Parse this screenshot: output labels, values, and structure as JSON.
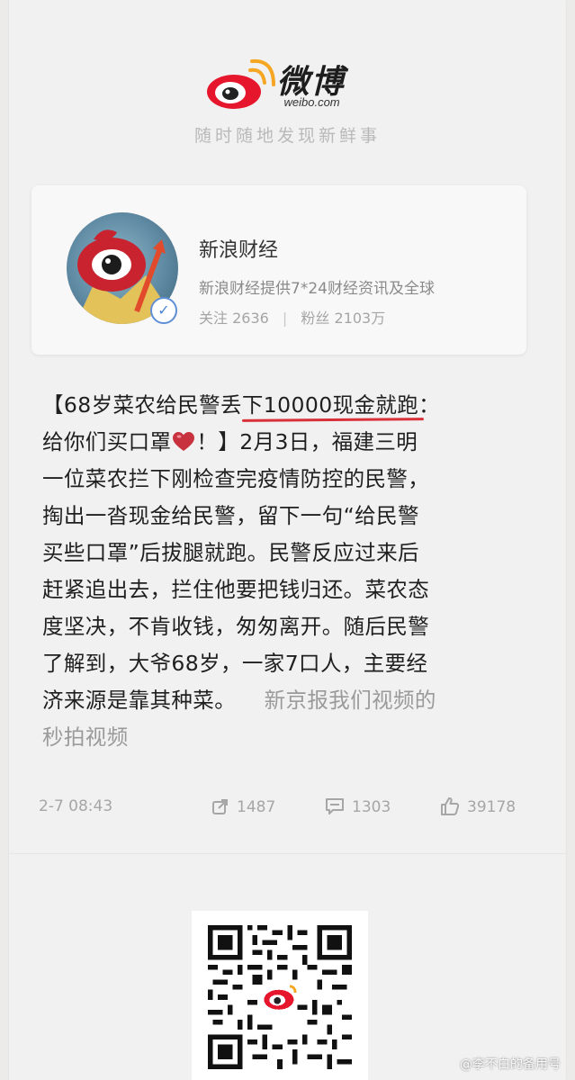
{
  "header": {
    "logo_text": "微博",
    "logo_sub": "weibo.com",
    "slogan": "随时随地发现新鲜事"
  },
  "profile": {
    "name": "新浪财经",
    "description": "新浪财经提供7*24财经资讯及全球",
    "follow_label": "关注",
    "follow_count": "2636",
    "fans_label": "粉丝",
    "fans_count": "2103万",
    "avatar_tag": "新浪"
  },
  "post": {
    "lines": [
      [
        "【68岁菜农给民警丢",
        "下10000现金就跑",
        "："
      ],
      [
        "给你们买口罩",
        "！】2月3日，福建三明"
      ],
      [
        "一位菜农拦下刚检查完疫情防控的民警，"
      ],
      [
        "掏出一沓现金给民警，留下一句“给民警"
      ],
      [
        "买些口罩”后拔腿就跑。民警反应过来后"
      ],
      [
        "赶紧追出去，拦住他要把钱归还。菜农态"
      ],
      [
        "度坚决，不肯收钱，匆匆离开。随后民警"
      ],
      [
        "了解到，大爷68岁，一家7口人，主要经"
      ],
      [
        "济来源是靠其种菜。",
        "新京报我们视频的"
      ],
      [
        "秒拍视频"
      ]
    ]
  },
  "meta": {
    "time": "2-7 08:43",
    "reposts": "1487",
    "comments": "1303",
    "likes": "39178"
  },
  "watermark": "@李不白的备用号",
  "colors": {
    "accent_red": "#d8313a",
    "heart": "#c8323f",
    "verify_blue": "#4b84d8"
  }
}
